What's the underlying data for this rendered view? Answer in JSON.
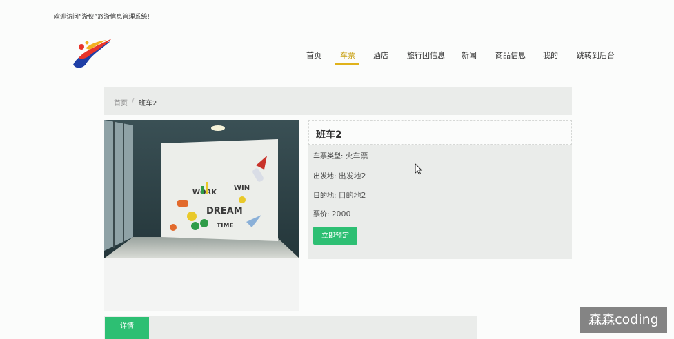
{
  "header": {
    "welcome": "欢迎访问“游侠”旅游信息管理系统!"
  },
  "logo": {
    "icon": "swoosh-logo"
  },
  "nav": {
    "items": [
      "首页",
      "车票",
      "酒店",
      "旅行团信息",
      "新闻",
      "商品信息",
      "我的",
      "跳转到后台"
    ],
    "active_index": 1,
    "accent_color": "#e0b21a"
  },
  "breadcrumb": {
    "home": "首页",
    "separator": "/",
    "current": "班车2"
  },
  "product": {
    "title": "班车2",
    "fields": [
      {
        "label": "车票类型:",
        "value": "火车票"
      },
      {
        "label": "出发地:",
        "value": "出发地2"
      },
      {
        "label": "目的地:",
        "value": "目的地2"
      },
      {
        "label": "票价:",
        "value": "2000"
      }
    ],
    "book_button": "立即预定",
    "button_color": "#2dbf73"
  },
  "tabs": {
    "details": "详情"
  },
  "watermark": "森森coding"
}
